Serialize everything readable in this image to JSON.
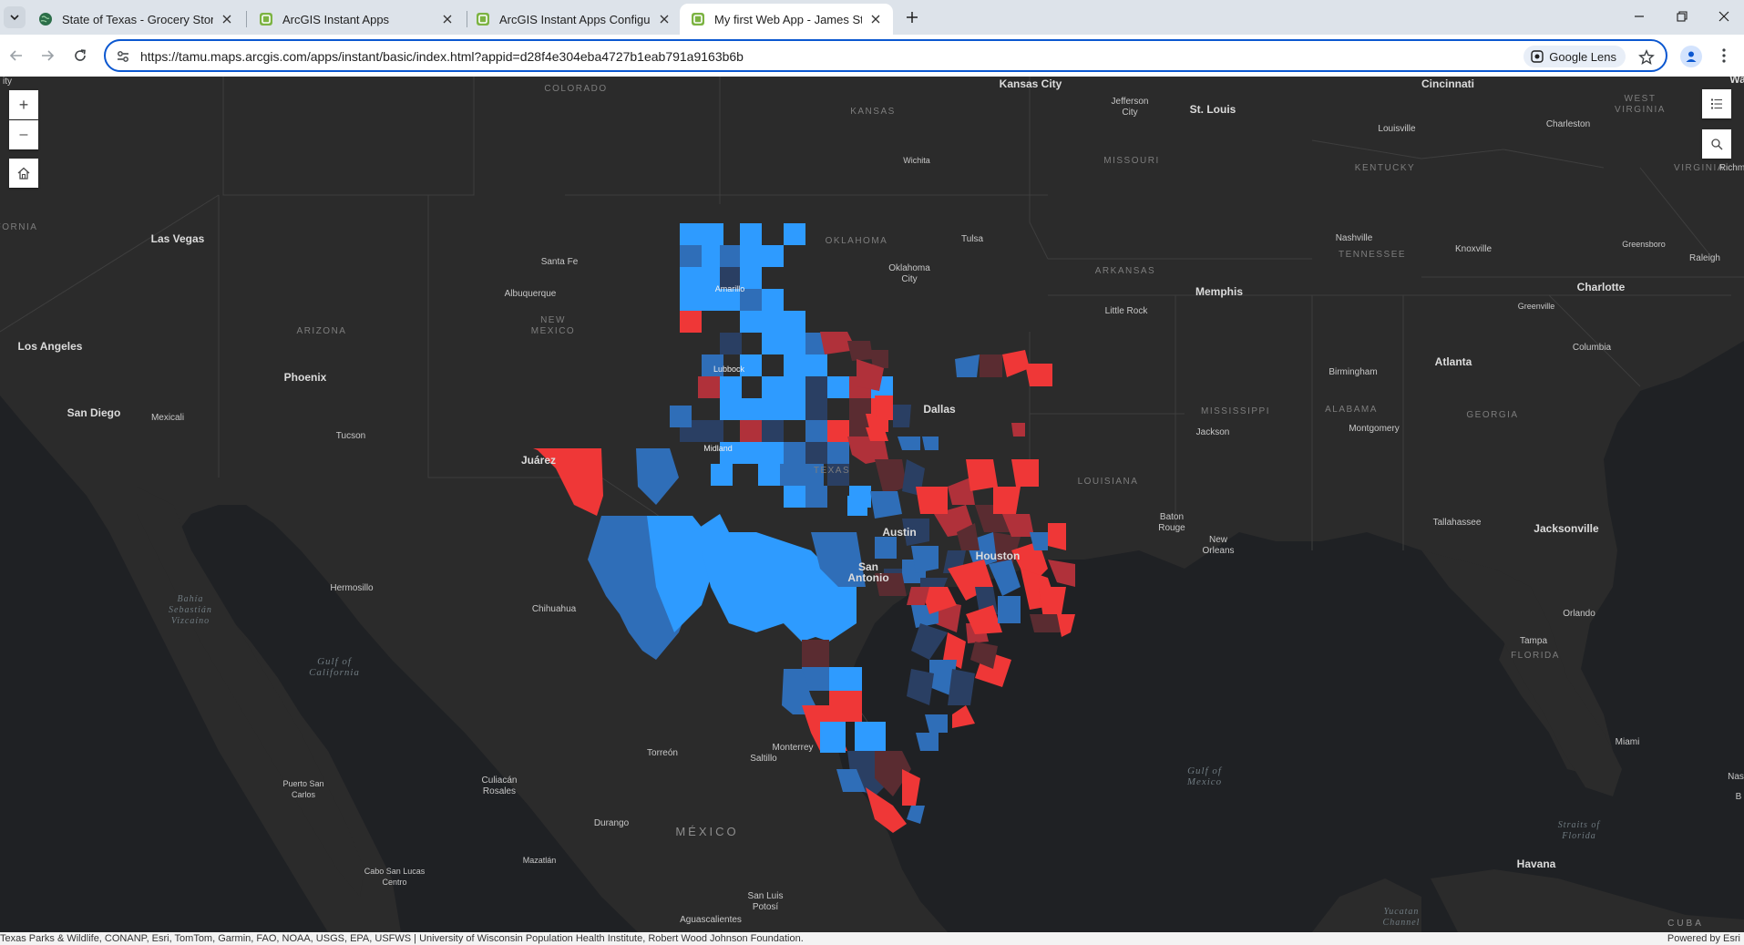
{
  "browser": {
    "tabs": [
      {
        "title": "State of Texas - Grocery Store",
        "active": false
      },
      {
        "title": "ArcGIS Instant Apps",
        "active": false
      },
      {
        "title": "ArcGIS Instant Apps Configurati",
        "active": false
      },
      {
        "title": "My first Web App - James Strick",
        "active": true
      }
    ],
    "url": "https://tamu.maps.arcgis.com/apps/instant/basic/index.html?appid=d28f4e304eba4727b1eab791a9163b6b",
    "lens_label": "Google Lens"
  },
  "map": {
    "labels": {
      "states": [
        {
          "text": "COLORADO"
        },
        {
          "text": "KANSAS"
        },
        {
          "text": "MISSOURI"
        },
        {
          "text": "KENTUCKY"
        },
        {
          "text": "WEST VIRGINIA"
        },
        {
          "text": "VIRGINIA"
        },
        {
          "text": "OKLAHOMA"
        },
        {
          "text": "ARKANSAS"
        },
        {
          "text": "TENNESSEE"
        },
        {
          "text": "ARIZONA"
        },
        {
          "text": "NEW MEXICO"
        },
        {
          "text": "MISSISSIPPI"
        },
        {
          "text": "ALABAMA"
        },
        {
          "text": "GEORGIA"
        },
        {
          "text": "LOUISIANA"
        },
        {
          "text": "TEXAS"
        },
        {
          "text": "FLORIDA"
        },
        {
          "text": "FORNIA"
        }
      ],
      "countries": [
        {
          "text": "MÉXICO"
        },
        {
          "text": "CUBA"
        }
      ],
      "cities": [
        {
          "text": "Kansas City"
        },
        {
          "text": "Jefferson City"
        },
        {
          "text": "St. Louis"
        },
        {
          "text": "Cincinnati"
        },
        {
          "text": "Charleston"
        },
        {
          "text": "Louisville"
        },
        {
          "text": "Wichita"
        },
        {
          "text": "Las Vegas"
        },
        {
          "text": "Santa Fe"
        },
        {
          "text": "Albuquerque"
        },
        {
          "text": "Amarillo"
        },
        {
          "text": "Tulsa"
        },
        {
          "text": "Oklahoma City"
        },
        {
          "text": "Nashville"
        },
        {
          "text": "Knoxville"
        },
        {
          "text": "Greensboro"
        },
        {
          "text": "Raleigh"
        },
        {
          "text": "Memphis"
        },
        {
          "text": "Charlotte"
        },
        {
          "text": "Greenville"
        },
        {
          "text": "Little Rock"
        },
        {
          "text": "Los Angeles"
        },
        {
          "text": "Phoenix"
        },
        {
          "text": "Lubbock"
        },
        {
          "text": "Birmingham"
        },
        {
          "text": "Atlanta"
        },
        {
          "text": "Columbia"
        },
        {
          "text": "San Diego"
        },
        {
          "text": "Mexicali"
        },
        {
          "text": "Dallas"
        },
        {
          "text": "Jackson"
        },
        {
          "text": "Montgomery"
        },
        {
          "text": "Tucson"
        },
        {
          "text": "Midland"
        },
        {
          "text": "Juárez"
        },
        {
          "text": "Baton Rouge"
        },
        {
          "text": "New Orleans"
        },
        {
          "text": "Tallahassee"
        },
        {
          "text": "Jacksonville"
        },
        {
          "text": "Austin"
        },
        {
          "text": "Houston"
        },
        {
          "text": "San Antonio"
        },
        {
          "text": "Hermosillo"
        },
        {
          "text": "Chihuahua"
        },
        {
          "text": "Orlando"
        },
        {
          "text": "Tampa"
        },
        {
          "text": "Miami"
        },
        {
          "text": "Monterrey"
        },
        {
          "text": "Saltillo"
        },
        {
          "text": "Torreón"
        },
        {
          "text": "Puerto San Carlos"
        },
        {
          "text": "Culiacán Rosales"
        },
        {
          "text": "Durango"
        },
        {
          "text": "Mazatlán"
        },
        {
          "text": "Cabo San Lucas Centro"
        },
        {
          "text": "San Luis Potosí"
        },
        {
          "text": "Aguascalientes"
        },
        {
          "text": "Havana"
        },
        {
          "text": "Wa"
        },
        {
          "text": "Richm"
        },
        {
          "text": "Nas"
        },
        {
          "text": "B"
        },
        {
          "text": "ity"
        }
      ],
      "waters": [
        {
          "text": "Gulf of California"
        },
        {
          "text": "Bahía Sebastián Vizcaíno"
        },
        {
          "text": "Gulf of Mexico"
        },
        {
          "text": "Straits of Florida"
        },
        {
          "text": "Yucatan Channel"
        }
      ]
    },
    "controls": {
      "zoom_in": "+",
      "zoom_out": "–"
    },
    "colors": {
      "high_blue": "#2e9bff",
      "mid_blue": "#2f6eb8",
      "dark_blue": "#2a3f63",
      "high_red": "#ef3737",
      "mid_red": "#b0313a",
      "dark_red": "#5a2c31"
    },
    "attribution": "Texas Parks & Wildlife, CONANP, Esri, TomTom, Garmin, FAO, NOAA, USGS, EPA, USFWS | University of Wisconsin Population Health Institute, Robert Wood Johnson Foundation.",
    "powered_by": "Powered by Esri"
  }
}
